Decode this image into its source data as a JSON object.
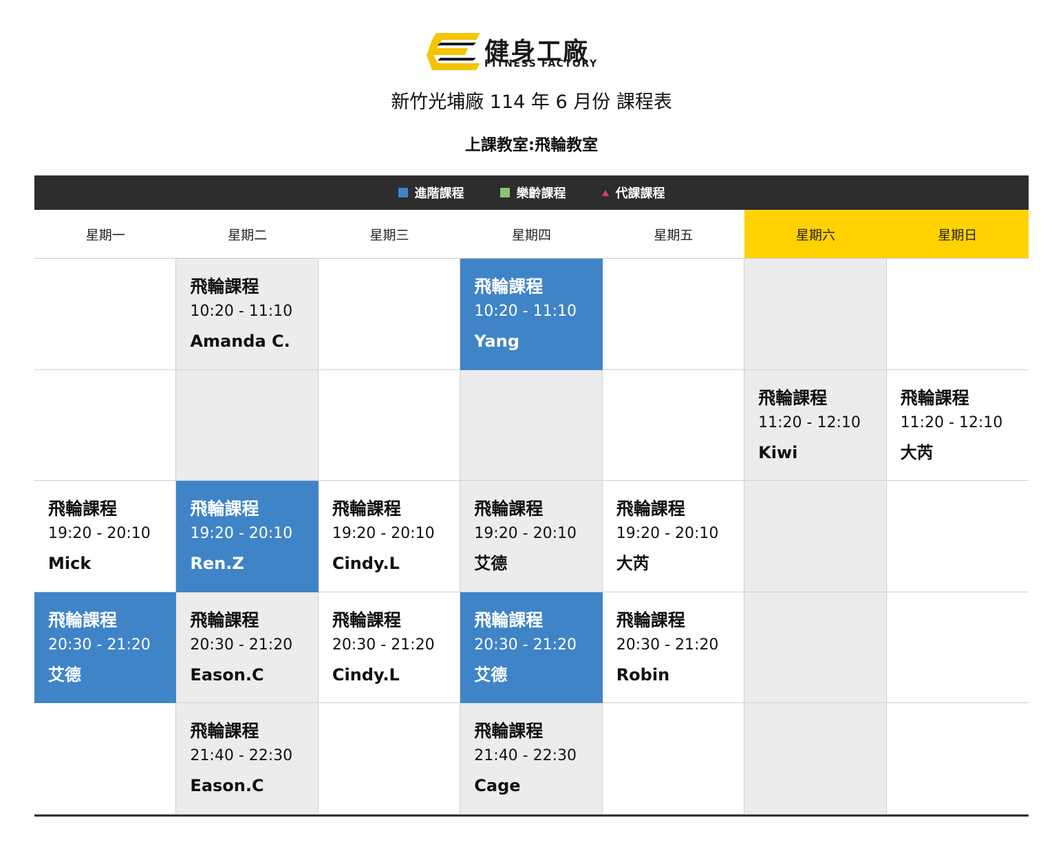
{
  "header": {
    "brand_zh": "健身工廠",
    "brand_en": "FITNESS FACTORY",
    "title": "新竹光埔廠 114 年 6 月份 課程表",
    "subtitle": "上課教室:飛輪教室"
  },
  "colors": {
    "advanced": "#3f84c7",
    "senior": "#8cc36e",
    "substitute": "#e23c6e",
    "weekend": "#ffd200",
    "gray_cell": "#ececec",
    "brand_yellow": "#f5c400"
  },
  "legend": [
    {
      "label": "進階課程",
      "icon": "blue-square-icon"
    },
    {
      "label": "樂齡課程",
      "icon": "green-square-icon"
    },
    {
      "label": "代課課程",
      "icon": "pink-triangle-icon"
    }
  ],
  "days": [
    "星期一",
    "星期二",
    "星期三",
    "星期四",
    "星期五",
    "星期六",
    "星期日"
  ],
  "rows": [
    [
      {
        "style": "white"
      },
      {
        "style": "gray",
        "name": "飛輪課程",
        "time": "10:20 - 11:10",
        "coach": "Amanda C."
      },
      {
        "style": "white"
      },
      {
        "style": "blue",
        "name": "飛輪課程",
        "time": "10:20 - 11:10",
        "coach": "Yang"
      },
      {
        "style": "white"
      },
      {
        "style": "gray"
      },
      {
        "style": "white"
      }
    ],
    [
      {
        "style": "white"
      },
      {
        "style": "gray"
      },
      {
        "style": "white"
      },
      {
        "style": "gray"
      },
      {
        "style": "white"
      },
      {
        "style": "gray",
        "name": "飛輪課程",
        "time": "11:20 - 12:10",
        "coach": "Kiwi"
      },
      {
        "style": "white",
        "name": "飛輪課程",
        "time": "11:20 - 12:10",
        "coach": "大芮"
      }
    ],
    [
      {
        "style": "white",
        "name": "飛輪課程",
        "time": "19:20 - 20:10",
        "coach": "Mick"
      },
      {
        "style": "blue",
        "name": "飛輪課程",
        "time": "19:20 - 20:10",
        "coach": "Ren.Z"
      },
      {
        "style": "white",
        "name": "飛輪課程",
        "time": "19:20 - 20:10",
        "coach": "Cindy.L"
      },
      {
        "style": "gray",
        "name": "飛輪課程",
        "time": "19:20 - 20:10",
        "coach": "艾德"
      },
      {
        "style": "white",
        "name": "飛輪課程",
        "time": "19:20 - 20:10",
        "coach": "大芮"
      },
      {
        "style": "gray"
      },
      {
        "style": "white"
      }
    ],
    [
      {
        "style": "blue",
        "name": "飛輪課程",
        "time": "20:30 - 21:20",
        "coach": "艾德"
      },
      {
        "style": "gray",
        "name": "飛輪課程",
        "time": "20:30 - 21:20",
        "coach": "Eason.C"
      },
      {
        "style": "white",
        "name": "飛輪課程",
        "time": "20:30 - 21:20",
        "coach": "Cindy.L"
      },
      {
        "style": "blue",
        "name": "飛輪課程",
        "time": "20:30 - 21:20",
        "coach": "艾德"
      },
      {
        "style": "white",
        "name": "飛輪課程",
        "time": "20:30 - 21:20",
        "coach": "Robin"
      },
      {
        "style": "gray"
      },
      {
        "style": "white"
      }
    ],
    [
      {
        "style": "white"
      },
      {
        "style": "gray",
        "name": "飛輪課程",
        "time": "21:40 - 22:30",
        "coach": "Eason.C"
      },
      {
        "style": "white"
      },
      {
        "style": "gray",
        "name": "飛輪課程",
        "time": "21:40 - 22:30",
        "coach": "Cage"
      },
      {
        "style": "white"
      },
      {
        "style": "gray"
      },
      {
        "style": "white"
      }
    ]
  ]
}
